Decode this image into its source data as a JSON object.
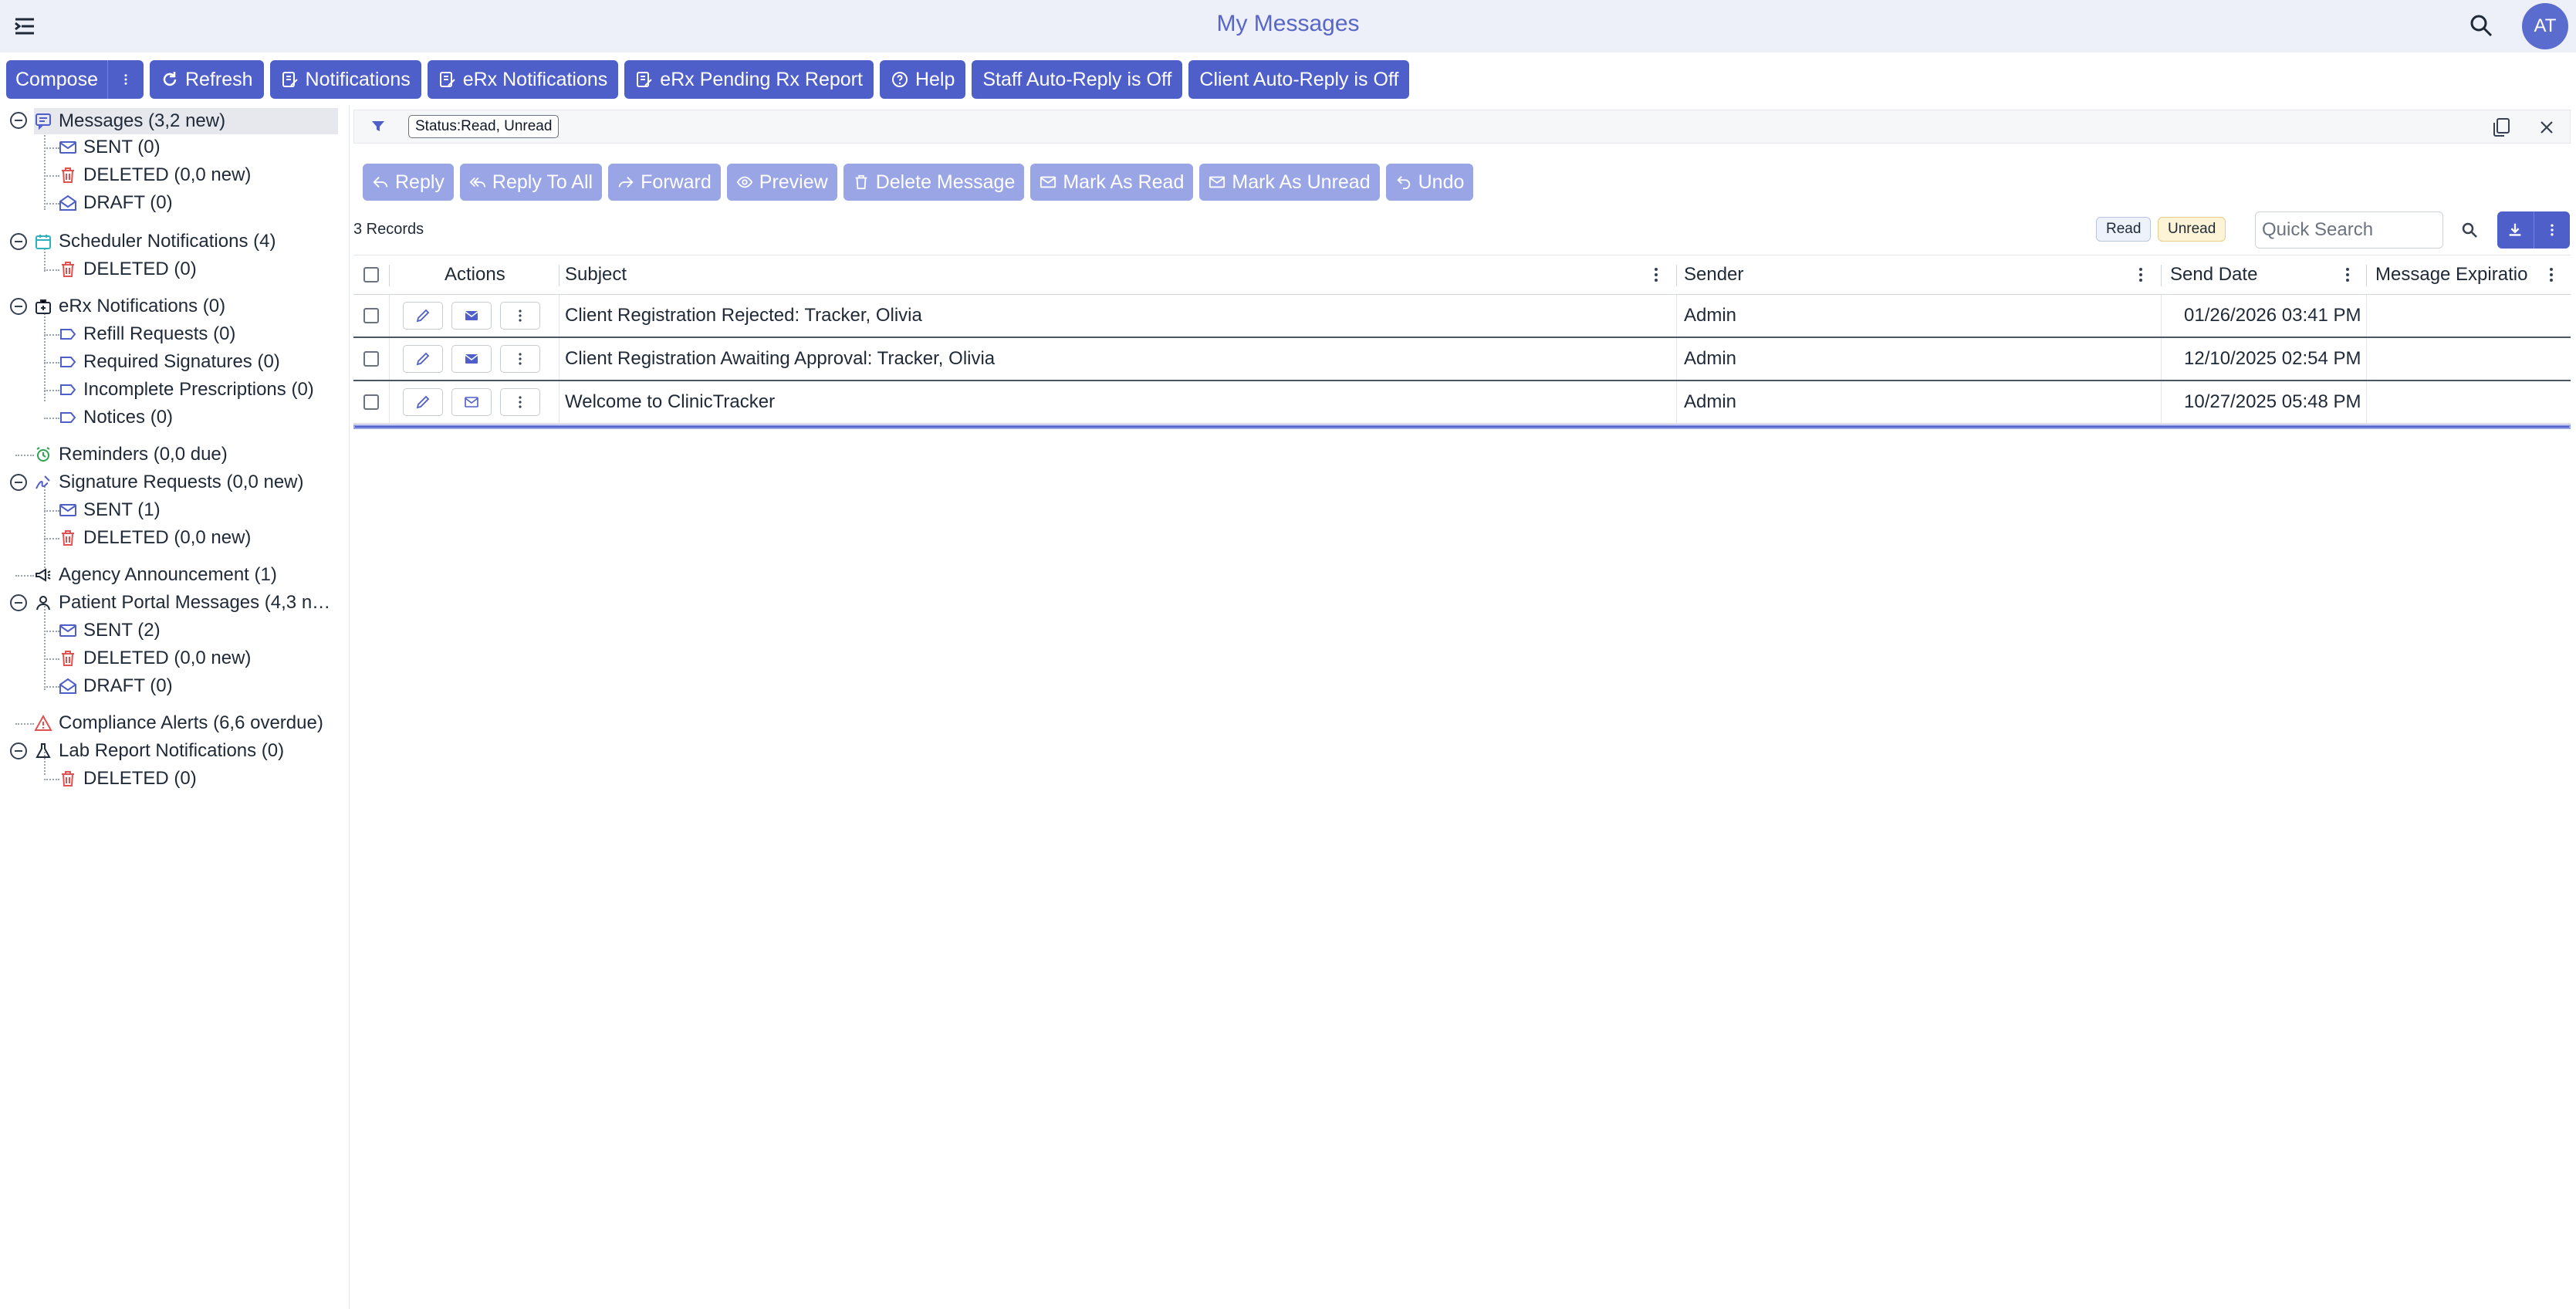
{
  "header": {
    "title": "My Messages",
    "avatar_initials": "AT",
    "menu_icon": "menu-toggle-icon",
    "search_icon": "search-icon"
  },
  "toolbar": {
    "compose": "Compose",
    "refresh": "Refresh",
    "notifications": "Notifications",
    "erx_notifications": "eRx Notifications",
    "erx_pending": "eRx Pending Rx Report",
    "help": "Help",
    "staff_auto_reply": "Staff Auto-Reply is Off",
    "client_auto_reply": "Client Auto-Reply is Off"
  },
  "tree": {
    "messages": "Messages (3,2 new)",
    "messages_sent": "SENT (0)",
    "messages_deleted": "DELETED (0,0 new)",
    "messages_draft": "DRAFT (0)",
    "scheduler": "Scheduler Notifications (4)",
    "scheduler_deleted": "DELETED (0)",
    "erx": "eRx Notifications (0)",
    "erx_refill": "Refill Requests (0)",
    "erx_signatures": "Required Signatures (0)",
    "erx_incomplete": "Incomplete Prescriptions (0)",
    "erx_notices": "Notices (0)",
    "reminders": "Reminders (0,0 due)",
    "signature_requests": "Signature Requests (0,0 new)",
    "sig_sent": "SENT (1)",
    "sig_deleted": "DELETED (0,0 new)",
    "agency": "Agency Announcement (1)",
    "portal": "Patient Portal Messages (4,3 n…",
    "portal_sent": "SENT (2)",
    "portal_deleted": "DELETED (0,0 new)",
    "portal_draft": "DRAFT (0)",
    "compliance": "Compliance Alerts (6,6 overdue)",
    "lab": "Lab Report Notifications (0)",
    "lab_deleted": "DELETED (0)"
  },
  "filter": {
    "chip": "Status:Read, Unread"
  },
  "actions": {
    "reply": "Reply",
    "reply_all": "Reply To All",
    "forward": "Forward",
    "preview": "Preview",
    "delete": "Delete Message",
    "mark_read": "Mark As Read",
    "mark_unread": "Mark As Unread",
    "undo": "Undo"
  },
  "grid": {
    "record_count": "3 Records",
    "legend_read": "Read",
    "legend_unread": "Unread",
    "quick_search_placeholder": "Quick Search",
    "columns": {
      "actions": "Actions",
      "subject": "Subject",
      "sender": "Sender",
      "send_date": "Send Date",
      "expiration": "Message Expiratio"
    },
    "rows": [
      {
        "subject": "Client Registration Rejected: Tracker, Olivia",
        "sender": "Admin",
        "send_date": "01/26/2026 03:41 PM",
        "expiration": "",
        "status": "unread"
      },
      {
        "subject": "Client Registration Awaiting Approval: Tracker, Olivia",
        "sender": "Admin",
        "send_date": "12/10/2025 02:54 PM",
        "expiration": "",
        "status": "unread"
      },
      {
        "subject": "Welcome to ClinicTracker",
        "sender": "Admin",
        "send_date": "10/27/2025 05:48 PM",
        "expiration": "",
        "status": "read"
      }
    ]
  },
  "colors": {
    "primary": "#4f5fca",
    "disabled_action": "#9aa5e6",
    "title": "#5866c9",
    "danger": "#e05252"
  }
}
